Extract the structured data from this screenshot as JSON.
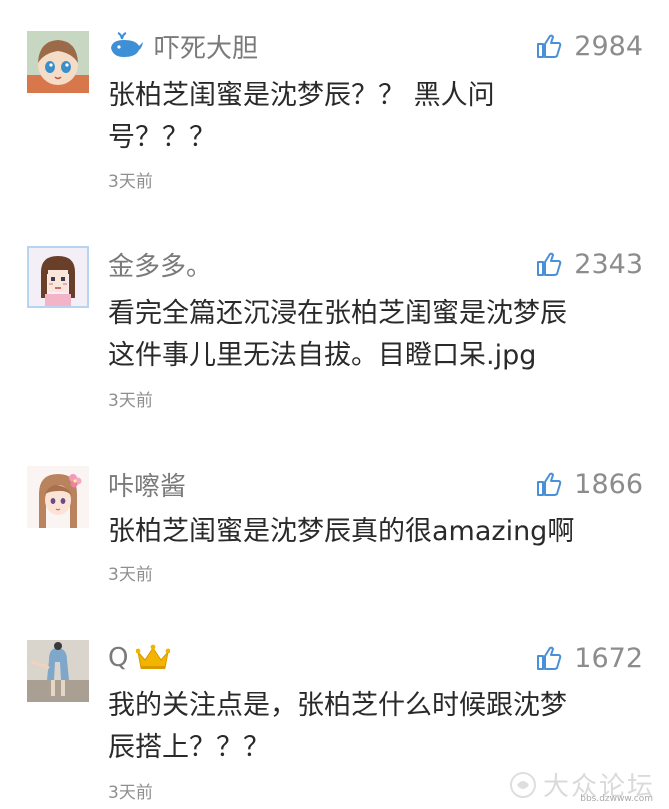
{
  "comments": [
    {
      "name": "吓死大胆",
      "likes": "2984",
      "text_lines": [
        "张柏芝闺蜜是沈梦辰？？ 黑人问",
        "号？？？"
      ],
      "time": "3天前",
      "name_icon": "whale-icon"
    },
    {
      "name": "金多多。",
      "likes": "2343",
      "text_lines": [
        "看完全篇还沉浸在张柏芝闺蜜是沈梦辰",
        "这件事儿里无法自拔。目瞪口呆.jpg"
      ],
      "time": "3天前"
    },
    {
      "name": "咔嚓酱",
      "likes": "1866",
      "text_lines": [
        "张柏芝闺蜜是沈梦辰真的很amazing啊"
      ],
      "time": "3天前"
    },
    {
      "name": "Q",
      "likes": "1672",
      "text_lines": [
        "我的关注点是，张柏芝什么时候跟沈梦",
        "辰搭上？？？"
      ],
      "time": "3天前",
      "name_icon": "crown-icon"
    }
  ],
  "watermark": {
    "text": "大众论坛",
    "url": "bbs.dzwww.com"
  },
  "colors": {
    "name": "#7a7a7a",
    "text": "#2a2a2a",
    "meta": "#8f8f8f",
    "like_icon": "#4a90d9",
    "crown": "#f3b400"
  }
}
